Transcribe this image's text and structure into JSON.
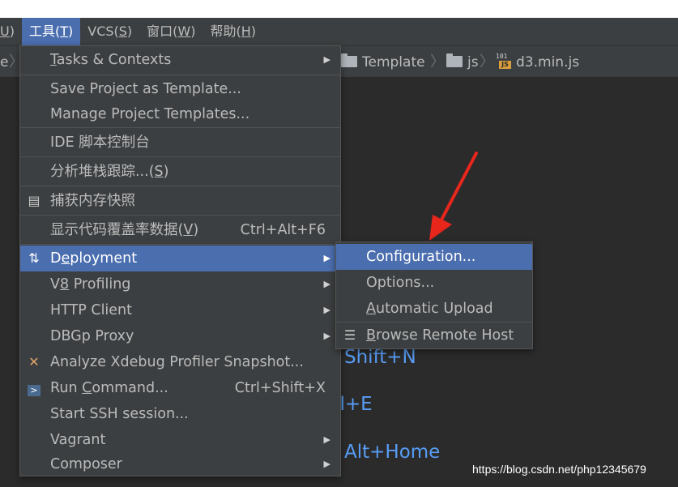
{
  "menubar": {
    "items": [
      {
        "name": "menu-partial",
        "pre": "",
        "key": "U",
        "post": ")",
        "show_paren": false
      },
      {
        "name": "menu-tools",
        "pre": "工具(",
        "key": "T",
        "post": ")"
      },
      {
        "name": "menu-vcs",
        "pre": "VCS(",
        "key": "S",
        "post": ")"
      },
      {
        "name": "menu-window",
        "pre": "窗口(",
        "key": "W",
        "post": ")"
      },
      {
        "name": "menu-help",
        "pre": "帮助(",
        "key": "H",
        "post": ")"
      }
    ]
  },
  "breadcrumb": {
    "partial": "e",
    "items": [
      "Template",
      "js",
      "d3.min.js"
    ],
    "file_icon_bits": "101",
    "file_icon_tag": "JS"
  },
  "tools_menu": {
    "tasks": {
      "pre": "",
      "key": "T",
      "post": "asks & Contexts"
    },
    "save_template": "Save Project as Template...",
    "manage_templates": "Manage Project Templates...",
    "ide_console": "IDE 脚本控制台",
    "analyze_stacktrace": {
      "pre": "分析堆栈跟踪...(",
      "key": "S",
      "post": ")"
    },
    "capture_memory": "捕获内存快照",
    "show_coverage": {
      "pre": "显示代码覆盖率数据(",
      "key": "V",
      "post": ")",
      "shortcut": "Ctrl+Alt+F6"
    },
    "deployment": {
      "pre": "D",
      "key": "e",
      "post": "ployment"
    },
    "v8_profiling": {
      "pre": "V",
      "key": "8",
      "post": " Profiling"
    },
    "http_client": "HTTP Client",
    "dbgp_proxy": "DBGp Proxy",
    "analyze_xdebug": "Analyze Xdebug Profiler Snapshot...",
    "run_command": {
      "pre": "Run ",
      "key": "C",
      "post": "ommand...",
      "shortcut": "Ctrl+Shift+X"
    },
    "start_ssh": "Start SSH session...",
    "vagrant": "Vagrant",
    "composer": "Composer"
  },
  "deployment_menu": {
    "configuration": "Configuration...",
    "options": "Options...",
    "automatic_upload": {
      "pre": "",
      "key": "A",
      "post": "utomatic Upload"
    },
    "browse_remote_host": {
      "pre": "",
      "key": "B",
      "post": "rowse Remote Host"
    }
  },
  "background_hints": [
    "Shift+N",
    "rl+E",
    "Alt+Home"
  ],
  "watermark": "https://blog.csdn.net/php12345679",
  "colors": {
    "selection": "#4b6eaf",
    "menu_bg": "#3c3f41",
    "editor_bg": "#2b2b2b",
    "hint": "#589df6",
    "arrow": "#e8261c"
  }
}
